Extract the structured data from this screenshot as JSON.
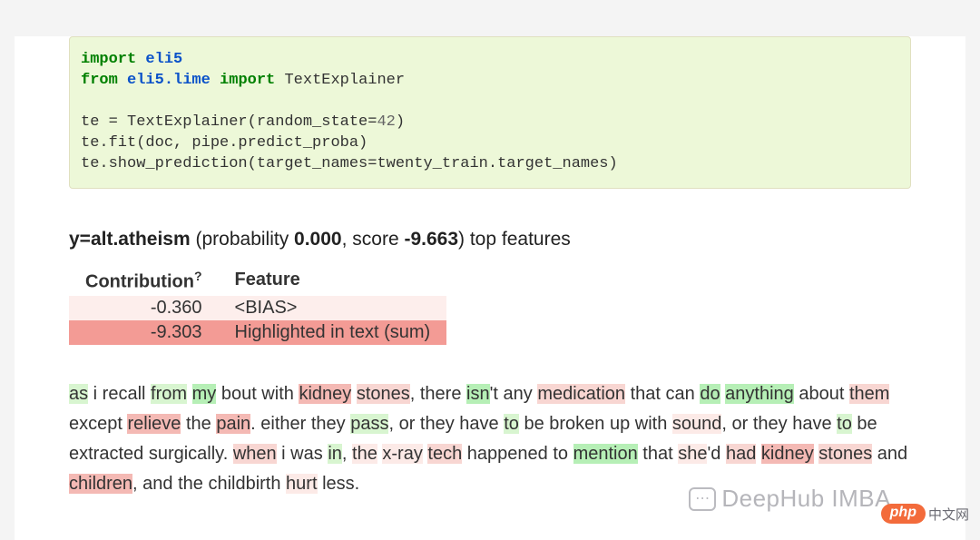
{
  "code": {
    "l1": {
      "kw": "import",
      "mod": "eli5"
    },
    "l2": {
      "kw1": "from",
      "mod": "eli5.lime",
      "kw2": "import",
      "rest": " TextExplainer"
    },
    "l3": {
      "pre": "te = TextExplainer(random_state=",
      "num": "42",
      "post": ")"
    },
    "l4": "te.fit(doc, pipe.predict_proba)",
    "l5": "te.show_prediction(target_names=twenty_train.target_names)"
  },
  "heading": {
    "y_label": "y=alt.atheism",
    "prob_label": " (probability ",
    "prob_val": "0.000",
    "score_label": ", score ",
    "score_val": "-9.663",
    "tail": ") top features"
  },
  "table": {
    "head_contrib": "Contribution",
    "head_sup": "?",
    "head_feature": "Feature",
    "rows": [
      {
        "contrib": "-0.360",
        "feature": "<BIAS>",
        "cls": "row-bias"
      },
      {
        "contrib": "-9.303",
        "feature": "Highlighted in text (sum)",
        "cls": "row-sum"
      }
    ]
  },
  "text": {
    "tokens": [
      {
        "t": "as",
        "c": "g2"
      },
      {
        "t": " i recall "
      },
      {
        "t": "from",
        "c": "g2"
      },
      {
        "t": " "
      },
      {
        "t": "my",
        "c": "g1"
      },
      {
        "t": " bout with "
      },
      {
        "t": "kidney",
        "c": "p2"
      },
      {
        "t": " "
      },
      {
        "t": "stones",
        "c": "p1"
      },
      {
        "t": ", there "
      },
      {
        "t": "isn",
        "c": "g1"
      },
      {
        "t": "'t any "
      },
      {
        "t": "medication",
        "c": "p1"
      },
      {
        "t": " that can "
      },
      {
        "t": "do",
        "c": "g1"
      },
      {
        "t": " "
      },
      {
        "t": "anything",
        "c": "g1"
      },
      {
        "t": " about "
      },
      {
        "t": "them",
        "c": "p1"
      },
      {
        "t": " except "
      },
      {
        "t": "relieve",
        "c": "p2"
      },
      {
        "t": " the "
      },
      {
        "t": "pain",
        "c": "p2"
      },
      {
        "t": ". either they "
      },
      {
        "t": "pass",
        "c": "g2"
      },
      {
        "t": ", or they have "
      },
      {
        "t": "to",
        "c": "g2"
      },
      {
        "t": " be broken up with "
      },
      {
        "t": "sound",
        "c": "p3"
      },
      {
        "t": ", or they have "
      },
      {
        "t": "to",
        "c": "g2"
      },
      {
        "t": " be extracted surgically. "
      },
      {
        "t": "when",
        "c": "p1"
      },
      {
        "t": " i was "
      },
      {
        "t": "in",
        "c": "g2"
      },
      {
        "t": ", "
      },
      {
        "t": "the",
        "c": "p3"
      },
      {
        "t": " "
      },
      {
        "t": "x-ray",
        "c": "p3"
      },
      {
        "t": " "
      },
      {
        "t": "tech",
        "c": "p1"
      },
      {
        "t": " happened to "
      },
      {
        "t": "mention",
        "c": "g1"
      },
      {
        "t": " that "
      },
      {
        "t": "she",
        "c": "p3"
      },
      {
        "t": "'d "
      },
      {
        "t": "had",
        "c": "p1"
      },
      {
        "t": " "
      },
      {
        "t": "kidney",
        "c": "p2"
      },
      {
        "t": " "
      },
      {
        "t": "stones",
        "c": "p1"
      },
      {
        "t": " and "
      },
      {
        "t": "children",
        "c": "p2"
      },
      {
        "t": ", and the childbirth "
      },
      {
        "t": "hurt",
        "c": "p3"
      },
      {
        "t": " less."
      }
    ]
  },
  "watermark": {
    "left": "DeepHub IMBA",
    "php": "php",
    "cn": "中文网"
  }
}
